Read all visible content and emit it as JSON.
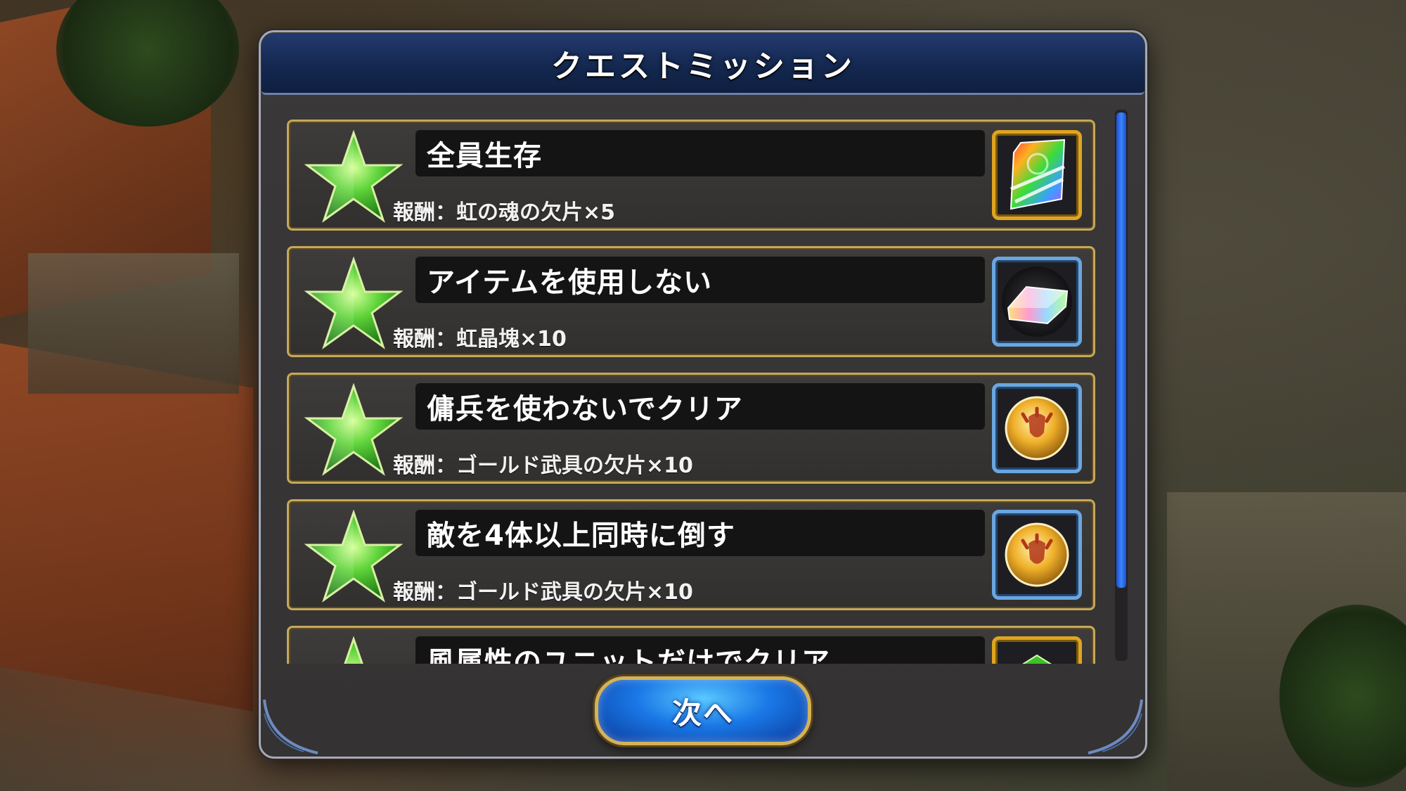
{
  "header": {
    "title": "クエストミッション"
  },
  "missions": [
    {
      "name": "全員生存",
      "reward": "報酬：虹の魂の欠片×5",
      "reward_icon": "rainbow-soul-shard-icon",
      "frame": "gold"
    },
    {
      "name": "アイテムを使用しない",
      "reward": "報酬：虹晶塊×10",
      "reward_icon": "rainbow-crystal-ingot-icon",
      "frame": "blue"
    },
    {
      "name": "傭兵を使わないでクリア",
      "reward": "報酬：ゴールド武具の欠片×10",
      "reward_icon": "gold-equipment-shard-icon",
      "frame": "blue"
    },
    {
      "name": "敵を4体以上同時に倒す",
      "reward": "報酬：ゴールド武具の欠片×10",
      "reward_icon": "gold-equipment-shard-icon",
      "frame": "blue"
    },
    {
      "name": "風属性のユニットだけでクリア",
      "reward": "",
      "reward_icon": "green-item-icon",
      "frame": "gold"
    }
  ],
  "footer": {
    "next_label": "次へ"
  },
  "colors": {
    "title_bar": "#142850",
    "card_border": "#c6a85a",
    "star_green": "#3fbf2a",
    "button_blue": "#1a78e6",
    "scroll_thumb": "#3a86ff"
  }
}
